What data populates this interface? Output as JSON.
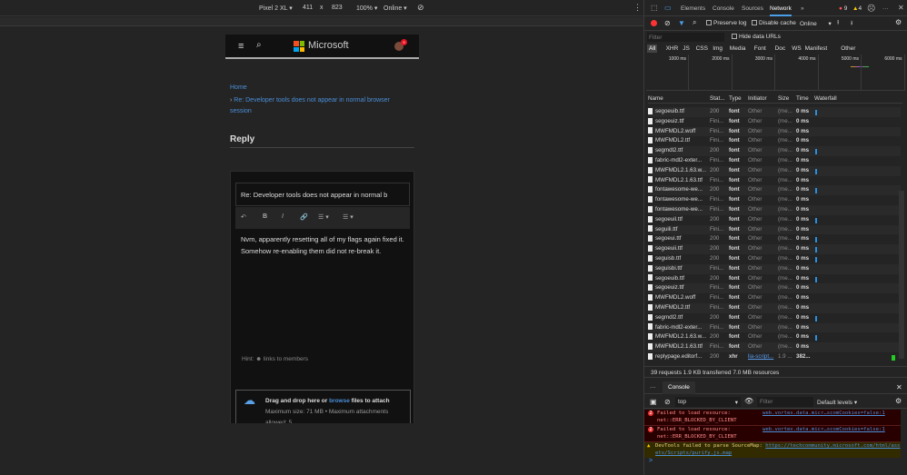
{
  "device_toolbar": {
    "device": "Pixel 2 XL",
    "width": "411",
    "x": "x",
    "height": "823",
    "zoom": "100%",
    "throttle": "Online"
  },
  "page": {
    "brand": "Microsoft",
    "notif_count": "9",
    "breadcrumb_home": "Home",
    "breadcrumb_current": "Re: Developer tools does not appear in normal browser session",
    "heading": "Reply",
    "subject": "Re: Developer tools does not appear in normal b",
    "body_lines": [
      "Nvm, apparently resetting all of my flags again fixed it.",
      "Somehow re-enabling them did not re-break it."
    ],
    "hint_label": "Hint:",
    "hint_text": "links to members",
    "attach_pre": "Drag and drop here or ",
    "attach_link": "browse",
    "attach_post": " files to attach",
    "attach_limits": "Maximum size: 71 MB • Maximum attachments allowed: 5"
  },
  "devtools": {
    "tabs": [
      "Elements",
      "Console",
      "Sources",
      "Network"
    ],
    "more": "»",
    "errors": "9",
    "warnings": "4",
    "toolbar": {
      "preserve_log": "Preserve log",
      "disable_cache": "Disable cache",
      "throttle": "Online"
    },
    "filter_placeholder": "Filter",
    "hide_data_urls": "Hide data URLs",
    "types": [
      "All",
      "XHR",
      "JS",
      "CSS",
      "Img",
      "Media",
      "Font",
      "Doc",
      "WS",
      "Manifest",
      "Other"
    ],
    "timeline": [
      "1000 ms",
      "2000 ms",
      "3000 ms",
      "4000 ms",
      "5000 ms",
      "6000 ms"
    ],
    "columns": [
      "Name",
      "Stat...",
      "Type",
      "Initiator",
      "Size",
      "Time",
      "Waterfall"
    ],
    "rows": [
      [
        "segoeuib.ttf",
        "200",
        "font",
        "Other",
        "(me...",
        "0 ms"
      ],
      [
        "segoeuiz.ttf",
        "Fini...",
        "font",
        "Other",
        "(me...",
        "0 ms"
      ],
      [
        "MWFMDL2.woff",
        "Fini...",
        "font",
        "Other",
        "(me...",
        "0 ms"
      ],
      [
        "MWFMDL2.ttf",
        "Fini...",
        "font",
        "Other",
        "(me...",
        "0 ms"
      ],
      [
        "segmdl2.ttf",
        "200",
        "font",
        "Other",
        "(me...",
        "0 ms"
      ],
      [
        "fabric-mdl2-exter...",
        "Fini...",
        "font",
        "Other",
        "(me...",
        "0 ms"
      ],
      [
        "MWFMDL2.1.63.w...",
        "200",
        "font",
        "Other",
        "(me...",
        "0 ms"
      ],
      [
        "MWFMDL2.1.63.ttf",
        "Fini...",
        "font",
        "Other",
        "(me...",
        "0 ms"
      ],
      [
        "fontawesome-we...",
        "200",
        "font",
        "Other",
        "(me...",
        "0 ms"
      ],
      [
        "fontawesome-we...",
        "Fini...",
        "font",
        "Other",
        "(me...",
        "0 ms"
      ],
      [
        "fontawesome-we...",
        "Fini...",
        "font",
        "Other",
        "(me...",
        "0 ms"
      ],
      [
        "segoeuil.ttf",
        "200",
        "font",
        "Other",
        "(me...",
        "0 ms"
      ],
      [
        "seguili.ttf",
        "Fini...",
        "font",
        "Other",
        "(me...",
        "0 ms"
      ],
      [
        "segoeui.ttf",
        "200",
        "font",
        "Other",
        "(me...",
        "0 ms"
      ],
      [
        "segoeuii.ttf",
        "200",
        "font",
        "Other",
        "(me...",
        "0 ms"
      ],
      [
        "seguisb.ttf",
        "200",
        "font",
        "Other",
        "(me...",
        "0 ms"
      ],
      [
        "seguisbi.ttf",
        "Fini...",
        "font",
        "Other",
        "(me...",
        "0 ms"
      ],
      [
        "segoeuib.ttf",
        "200",
        "font",
        "Other",
        "(me...",
        "0 ms"
      ],
      [
        "segoeuiz.ttf",
        "Fini...",
        "font",
        "Other",
        "(me...",
        "0 ms"
      ],
      [
        "MWFMDL2.woff",
        "Fini...",
        "font",
        "Other",
        "(me...",
        "0 ms"
      ],
      [
        "MWFMDL2.ttf",
        "Fini...",
        "font",
        "Other",
        "(me...",
        "0 ms"
      ],
      [
        "segmdl2.ttf",
        "200",
        "font",
        "Other",
        "(me...",
        "0 ms"
      ],
      [
        "fabric-mdl2-exter...",
        "Fini...",
        "font",
        "Other",
        "(me...",
        "0 ms"
      ],
      [
        "MWFMDL2.1.63.w...",
        "200",
        "font",
        "Other",
        "(me...",
        "0 ms"
      ],
      [
        "MWFMDL2.1.63.ttf",
        "Fini...",
        "font",
        "Other",
        "(me...",
        "0 ms"
      ],
      [
        "replypage.editorf...",
        "200",
        "xhr",
        "lia-script...",
        "1.9 ...",
        "382..."
      ]
    ],
    "summary": "39 requests  1.9 KB transferred  7.0 MB resources",
    "console": {
      "tab": "Console",
      "context": "top",
      "filter_placeholder": "Filter",
      "levels": "Default levels",
      "messages": [
        {
          "type": "error",
          "count": "2",
          "text": "Failed to load resource: net::ERR_BLOCKED_BY_CLIENT",
          "source": "web.vortex.data.micr…scomCookies=false:1"
        },
        {
          "type": "error",
          "count": "2",
          "text": "Failed to load resource: net::ERR_BLOCKED_BY_CLIENT",
          "source": "web.vortex.data.micr…scomCookies=false:1"
        },
        {
          "type": "warning",
          "text": "DevTools failed to parse SourceMap: ",
          "link": "https://techcommunity.microsoft.com/html/assets/Scripts/purify.js.map"
        }
      ],
      "prompt": ">"
    }
  }
}
